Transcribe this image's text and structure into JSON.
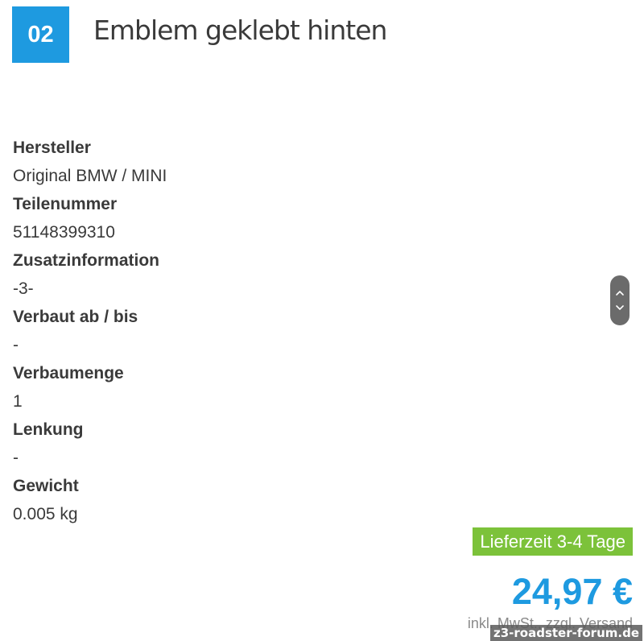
{
  "header": {
    "position_number": "02",
    "title": "Emblem geklebt hinten",
    "accent_color": "#1e9ae0"
  },
  "specs": [
    {
      "label": "Hersteller",
      "value": "Original BMW / MINI"
    },
    {
      "label": "Teilenummer",
      "value": "51148399310"
    },
    {
      "label": "Zusatzinformation",
      "value": "-3-"
    },
    {
      "label": "Verbaut ab / bis",
      "value": "-"
    },
    {
      "label": "Verbaumenge",
      "value": "1"
    },
    {
      "label": "Lenkung",
      "value": "-"
    },
    {
      "label": "Gewicht",
      "value": "0.005 kg"
    }
  ],
  "scroll_control": {
    "up_icon": "chevron-up-icon",
    "down_icon": "chevron-down-icon"
  },
  "pricing": {
    "delivery_label": "Lieferzeit 3-4 Tage",
    "delivery_color": "#7cc23a",
    "price": "24,97 €",
    "price_color": "#1e9ae0",
    "tax_note": "inkl. MwSt., zzgl. Versand"
  },
  "watermark": {
    "text": "z3-roadster-forum.de"
  }
}
